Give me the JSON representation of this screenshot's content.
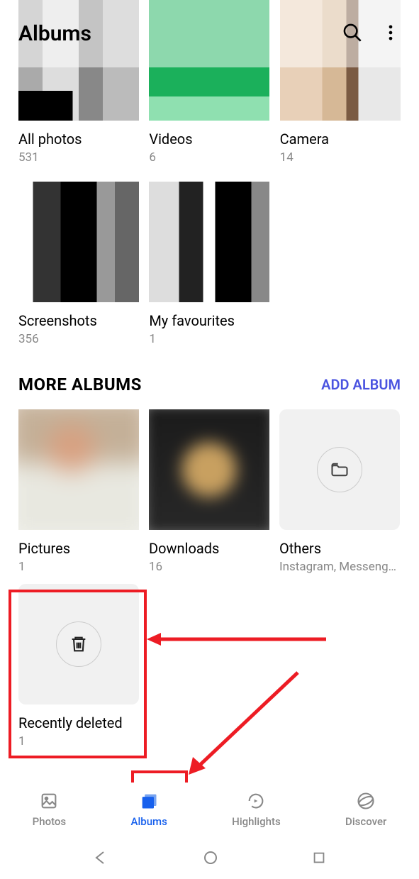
{
  "header": {
    "title": "Albums"
  },
  "top_albums": [
    {
      "title": "All photos",
      "count": "531"
    },
    {
      "title": "Videos",
      "count": "6"
    },
    {
      "title": "Camera",
      "count": "14"
    },
    {
      "title": "Screenshots",
      "count": "356"
    },
    {
      "title": "My favourites",
      "count": "1"
    }
  ],
  "more_section": {
    "header": "MORE ALBUMS",
    "action": "ADD ALBUM"
  },
  "more_albums": [
    {
      "title": "Pictures",
      "count": "1"
    },
    {
      "title": "Downloads",
      "count": "16"
    },
    {
      "title": "Others",
      "sub": "Instagram, Messenge…"
    },
    {
      "title": "Recently deleted",
      "count": "1"
    }
  ],
  "nav": {
    "photos": "Photos",
    "albums": "Albums",
    "highlights": "Highlights",
    "discover": "Discover"
  }
}
